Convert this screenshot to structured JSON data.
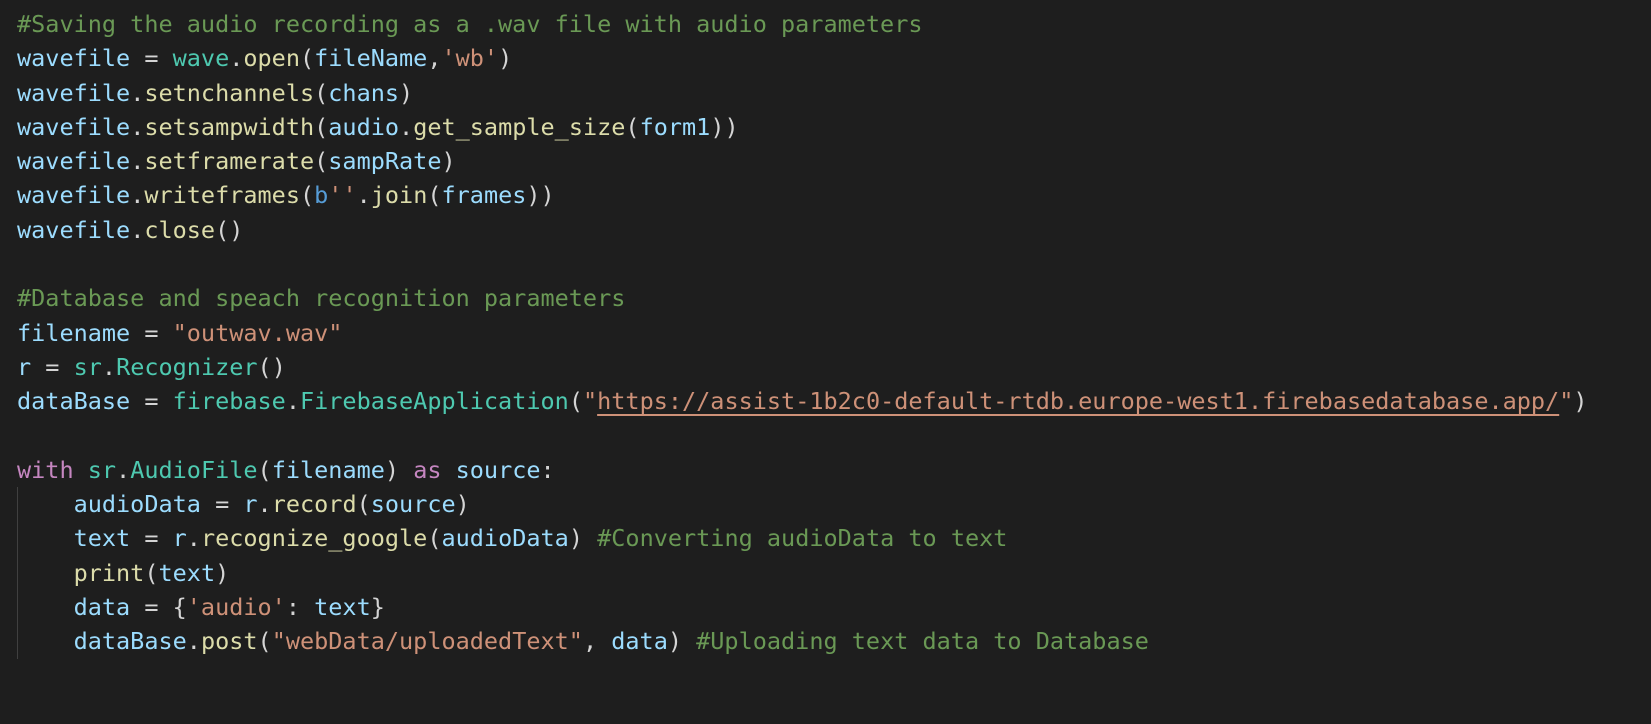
{
  "colors": {
    "background": "#1e1e1e",
    "comment": "#6a9955",
    "variable": "#9cdcfe",
    "class": "#4ec9b0",
    "function": "#dcdcaa",
    "string": "#ce9178",
    "keyword": "#c586c0",
    "storage": "#569cd6",
    "plain": "#d4d4d4",
    "indent_guide": "#404040"
  },
  "lines": [
    {
      "indent": 0,
      "tokens": [
        {
          "t": "#Saving the audio recording as a .wav file with audio parameters",
          "c": "comment"
        }
      ]
    },
    {
      "indent": 0,
      "tokens": [
        {
          "t": "wavefile",
          "c": "variable"
        },
        {
          "t": " = ",
          "c": "plain"
        },
        {
          "t": "wave",
          "c": "class"
        },
        {
          "t": ".",
          "c": "plain"
        },
        {
          "t": "open",
          "c": "function"
        },
        {
          "t": "(",
          "c": "plain"
        },
        {
          "t": "fileName",
          "c": "variable"
        },
        {
          "t": ",",
          "c": "plain"
        },
        {
          "t": "'wb'",
          "c": "string"
        },
        {
          "t": ")",
          "c": "plain"
        }
      ]
    },
    {
      "indent": 0,
      "tokens": [
        {
          "t": "wavefile",
          "c": "variable"
        },
        {
          "t": ".",
          "c": "plain"
        },
        {
          "t": "setnchannels",
          "c": "function"
        },
        {
          "t": "(",
          "c": "plain"
        },
        {
          "t": "chans",
          "c": "variable"
        },
        {
          "t": ")",
          "c": "plain"
        }
      ]
    },
    {
      "indent": 0,
      "tokens": [
        {
          "t": "wavefile",
          "c": "variable"
        },
        {
          "t": ".",
          "c": "plain"
        },
        {
          "t": "setsampwidth",
          "c": "function"
        },
        {
          "t": "(",
          "c": "plain"
        },
        {
          "t": "audio",
          "c": "variable"
        },
        {
          "t": ".",
          "c": "plain"
        },
        {
          "t": "get_sample_size",
          "c": "function"
        },
        {
          "t": "(",
          "c": "plain"
        },
        {
          "t": "form1",
          "c": "variable"
        },
        {
          "t": "))",
          "c": "plain"
        }
      ]
    },
    {
      "indent": 0,
      "tokens": [
        {
          "t": "wavefile",
          "c": "variable"
        },
        {
          "t": ".",
          "c": "plain"
        },
        {
          "t": "setframerate",
          "c": "function"
        },
        {
          "t": "(",
          "c": "plain"
        },
        {
          "t": "sampRate",
          "c": "variable"
        },
        {
          "t": ")",
          "c": "plain"
        }
      ]
    },
    {
      "indent": 0,
      "tokens": [
        {
          "t": "wavefile",
          "c": "variable"
        },
        {
          "t": ".",
          "c": "plain"
        },
        {
          "t": "writeframes",
          "c": "function"
        },
        {
          "t": "(",
          "c": "plain"
        },
        {
          "t": "b",
          "c": "storage"
        },
        {
          "t": "''",
          "c": "string"
        },
        {
          "t": ".",
          "c": "plain"
        },
        {
          "t": "join",
          "c": "function"
        },
        {
          "t": "(",
          "c": "plain"
        },
        {
          "t": "frames",
          "c": "variable"
        },
        {
          "t": "))",
          "c": "plain"
        }
      ]
    },
    {
      "indent": 0,
      "tokens": [
        {
          "t": "wavefile",
          "c": "variable"
        },
        {
          "t": ".",
          "c": "plain"
        },
        {
          "t": "close",
          "c": "function"
        },
        {
          "t": "()",
          "c": "plain"
        }
      ]
    },
    {
      "indent": 0,
      "tokens": []
    },
    {
      "indent": 0,
      "tokens": [
        {
          "t": "#Database and speach recognition parameters",
          "c": "comment"
        }
      ]
    },
    {
      "indent": 0,
      "tokens": [
        {
          "t": "filename",
          "c": "variable"
        },
        {
          "t": " = ",
          "c": "plain"
        },
        {
          "t": "\"outwav.wav\"",
          "c": "string"
        }
      ]
    },
    {
      "indent": 0,
      "tokens": [
        {
          "t": "r",
          "c": "variable"
        },
        {
          "t": " = ",
          "c": "plain"
        },
        {
          "t": "sr",
          "c": "class"
        },
        {
          "t": ".",
          "c": "plain"
        },
        {
          "t": "Recognizer",
          "c": "class"
        },
        {
          "t": "()",
          "c": "plain"
        }
      ]
    },
    {
      "indent": 0,
      "tokens": [
        {
          "t": "dataBase",
          "c": "variable"
        },
        {
          "t": " = ",
          "c": "plain"
        },
        {
          "t": "firebase",
          "c": "class"
        },
        {
          "t": ".",
          "c": "plain"
        },
        {
          "t": "FirebaseApplication",
          "c": "class"
        },
        {
          "t": "(",
          "c": "plain"
        },
        {
          "t": "\"",
          "c": "string"
        },
        {
          "t": "https://assist-1b2c0-default-rtdb.europe-west1.firebasedatabase.app/",
          "c": "string",
          "url": true
        },
        {
          "t": "\"",
          "c": "string"
        },
        {
          "t": ")",
          "c": "plain"
        }
      ]
    },
    {
      "indent": 0,
      "tokens": []
    },
    {
      "indent": 0,
      "tokens": [
        {
          "t": "with",
          "c": "keyword"
        },
        {
          "t": " ",
          "c": "plain"
        },
        {
          "t": "sr",
          "c": "class"
        },
        {
          "t": ".",
          "c": "plain"
        },
        {
          "t": "AudioFile",
          "c": "class"
        },
        {
          "t": "(",
          "c": "plain"
        },
        {
          "t": "filename",
          "c": "variable"
        },
        {
          "t": ") ",
          "c": "plain"
        },
        {
          "t": "as",
          "c": "keyword"
        },
        {
          "t": " ",
          "c": "plain"
        },
        {
          "t": "source",
          "c": "variable"
        },
        {
          "t": ":",
          "c": "plain"
        }
      ]
    },
    {
      "indent": 1,
      "tokens": [
        {
          "t": "audioData",
          "c": "variable"
        },
        {
          "t": " = ",
          "c": "plain"
        },
        {
          "t": "r",
          "c": "variable"
        },
        {
          "t": ".",
          "c": "plain"
        },
        {
          "t": "record",
          "c": "function"
        },
        {
          "t": "(",
          "c": "plain"
        },
        {
          "t": "source",
          "c": "variable"
        },
        {
          "t": ")",
          "c": "plain"
        }
      ]
    },
    {
      "indent": 1,
      "tokens": [
        {
          "t": "text",
          "c": "variable"
        },
        {
          "t": " = ",
          "c": "plain"
        },
        {
          "t": "r",
          "c": "variable"
        },
        {
          "t": ".",
          "c": "plain"
        },
        {
          "t": "recognize_google",
          "c": "function"
        },
        {
          "t": "(",
          "c": "plain"
        },
        {
          "t": "audioData",
          "c": "variable"
        },
        {
          "t": ") ",
          "c": "plain"
        },
        {
          "t": "#Converting audioData to text",
          "c": "comment"
        }
      ]
    },
    {
      "indent": 1,
      "tokens": [
        {
          "t": "print",
          "c": "function"
        },
        {
          "t": "(",
          "c": "plain"
        },
        {
          "t": "text",
          "c": "variable"
        },
        {
          "t": ")",
          "c": "plain"
        }
      ]
    },
    {
      "indent": 1,
      "tokens": [
        {
          "t": "data",
          "c": "variable"
        },
        {
          "t": " = {",
          "c": "plain"
        },
        {
          "t": "'audio'",
          "c": "string"
        },
        {
          "t": ": ",
          "c": "plain"
        },
        {
          "t": "text",
          "c": "variable"
        },
        {
          "t": "}",
          "c": "plain"
        }
      ]
    },
    {
      "indent": 1,
      "tokens": [
        {
          "t": "dataBase",
          "c": "variable"
        },
        {
          "t": ".",
          "c": "plain"
        },
        {
          "t": "post",
          "c": "function"
        },
        {
          "t": "(",
          "c": "plain"
        },
        {
          "t": "\"webData/uploadedText\"",
          "c": "string"
        },
        {
          "t": ", ",
          "c": "plain"
        },
        {
          "t": "data",
          "c": "variable"
        },
        {
          "t": ") ",
          "c": "plain"
        },
        {
          "t": "#Uploading text data to Database",
          "c": "comment"
        }
      ]
    }
  ]
}
